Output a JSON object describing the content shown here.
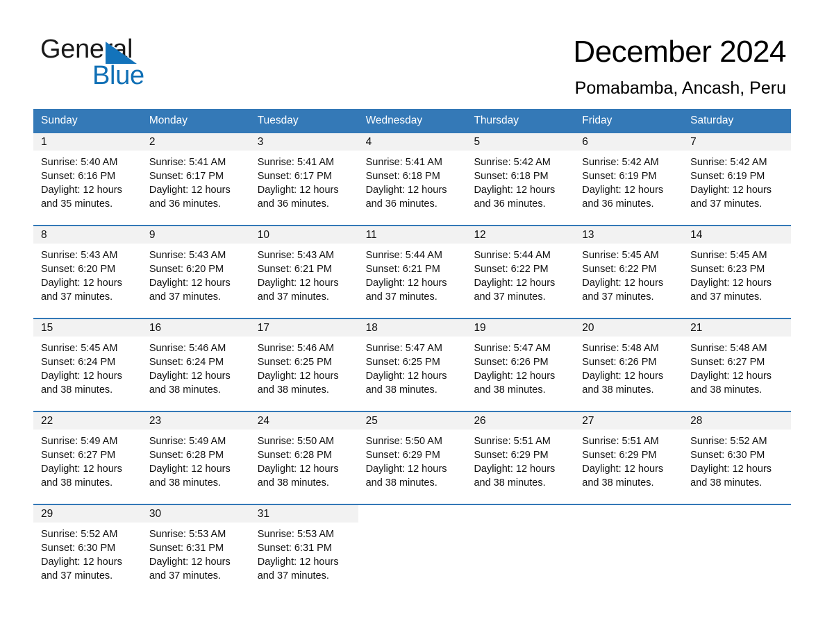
{
  "brand": {
    "word_one": "General",
    "word_two": "Blue",
    "triangle_color": "#1373bb",
    "blue_text_color": "#0f6fb5"
  },
  "header": {
    "month_title": "December 2024",
    "location": "Pomabamba, Ancash, Peru"
  },
  "calendar": {
    "header_bg": "#3479b7",
    "day_band_bg": "#f2f2f2",
    "weekdays": [
      "Sunday",
      "Monday",
      "Tuesday",
      "Wednesday",
      "Thursday",
      "Friday",
      "Saturday"
    ],
    "weeks": [
      [
        {
          "day": "1",
          "sunrise": "Sunrise: 5:40 AM",
          "sunset": "Sunset: 6:16 PM",
          "daylight_line1": "Daylight: 12 hours",
          "daylight_line2": "and 35 minutes."
        },
        {
          "day": "2",
          "sunrise": "Sunrise: 5:41 AM",
          "sunset": "Sunset: 6:17 PM",
          "daylight_line1": "Daylight: 12 hours",
          "daylight_line2": "and 36 minutes."
        },
        {
          "day": "3",
          "sunrise": "Sunrise: 5:41 AM",
          "sunset": "Sunset: 6:17 PM",
          "daylight_line1": "Daylight: 12 hours",
          "daylight_line2": "and 36 minutes."
        },
        {
          "day": "4",
          "sunrise": "Sunrise: 5:41 AM",
          "sunset": "Sunset: 6:18 PM",
          "daylight_line1": "Daylight: 12 hours",
          "daylight_line2": "and 36 minutes."
        },
        {
          "day": "5",
          "sunrise": "Sunrise: 5:42 AM",
          "sunset": "Sunset: 6:18 PM",
          "daylight_line1": "Daylight: 12 hours",
          "daylight_line2": "and 36 minutes."
        },
        {
          "day": "6",
          "sunrise": "Sunrise: 5:42 AM",
          "sunset": "Sunset: 6:19 PM",
          "daylight_line1": "Daylight: 12 hours",
          "daylight_line2": "and 36 minutes."
        },
        {
          "day": "7",
          "sunrise": "Sunrise: 5:42 AM",
          "sunset": "Sunset: 6:19 PM",
          "daylight_line1": "Daylight: 12 hours",
          "daylight_line2": "and 37 minutes."
        }
      ],
      [
        {
          "day": "8",
          "sunrise": "Sunrise: 5:43 AM",
          "sunset": "Sunset: 6:20 PM",
          "daylight_line1": "Daylight: 12 hours",
          "daylight_line2": "and 37 minutes."
        },
        {
          "day": "9",
          "sunrise": "Sunrise: 5:43 AM",
          "sunset": "Sunset: 6:20 PM",
          "daylight_line1": "Daylight: 12 hours",
          "daylight_line2": "and 37 minutes."
        },
        {
          "day": "10",
          "sunrise": "Sunrise: 5:43 AM",
          "sunset": "Sunset: 6:21 PM",
          "daylight_line1": "Daylight: 12 hours",
          "daylight_line2": "and 37 minutes."
        },
        {
          "day": "11",
          "sunrise": "Sunrise: 5:44 AM",
          "sunset": "Sunset: 6:21 PM",
          "daylight_line1": "Daylight: 12 hours",
          "daylight_line2": "and 37 minutes."
        },
        {
          "day": "12",
          "sunrise": "Sunrise: 5:44 AM",
          "sunset": "Sunset: 6:22 PM",
          "daylight_line1": "Daylight: 12 hours",
          "daylight_line2": "and 37 minutes."
        },
        {
          "day": "13",
          "sunrise": "Sunrise: 5:45 AM",
          "sunset": "Sunset: 6:22 PM",
          "daylight_line1": "Daylight: 12 hours",
          "daylight_line2": "and 37 minutes."
        },
        {
          "day": "14",
          "sunrise": "Sunrise: 5:45 AM",
          "sunset": "Sunset: 6:23 PM",
          "daylight_line1": "Daylight: 12 hours",
          "daylight_line2": "and 37 minutes."
        }
      ],
      [
        {
          "day": "15",
          "sunrise": "Sunrise: 5:45 AM",
          "sunset": "Sunset: 6:24 PM",
          "daylight_line1": "Daylight: 12 hours",
          "daylight_line2": "and 38 minutes."
        },
        {
          "day": "16",
          "sunrise": "Sunrise: 5:46 AM",
          "sunset": "Sunset: 6:24 PM",
          "daylight_line1": "Daylight: 12 hours",
          "daylight_line2": "and 38 minutes."
        },
        {
          "day": "17",
          "sunrise": "Sunrise: 5:46 AM",
          "sunset": "Sunset: 6:25 PM",
          "daylight_line1": "Daylight: 12 hours",
          "daylight_line2": "and 38 minutes."
        },
        {
          "day": "18",
          "sunrise": "Sunrise: 5:47 AM",
          "sunset": "Sunset: 6:25 PM",
          "daylight_line1": "Daylight: 12 hours",
          "daylight_line2": "and 38 minutes."
        },
        {
          "day": "19",
          "sunrise": "Sunrise: 5:47 AM",
          "sunset": "Sunset: 6:26 PM",
          "daylight_line1": "Daylight: 12 hours",
          "daylight_line2": "and 38 minutes."
        },
        {
          "day": "20",
          "sunrise": "Sunrise: 5:48 AM",
          "sunset": "Sunset: 6:26 PM",
          "daylight_line1": "Daylight: 12 hours",
          "daylight_line2": "and 38 minutes."
        },
        {
          "day": "21",
          "sunrise": "Sunrise: 5:48 AM",
          "sunset": "Sunset: 6:27 PM",
          "daylight_line1": "Daylight: 12 hours",
          "daylight_line2": "and 38 minutes."
        }
      ],
      [
        {
          "day": "22",
          "sunrise": "Sunrise: 5:49 AM",
          "sunset": "Sunset: 6:27 PM",
          "daylight_line1": "Daylight: 12 hours",
          "daylight_line2": "and 38 minutes."
        },
        {
          "day": "23",
          "sunrise": "Sunrise: 5:49 AM",
          "sunset": "Sunset: 6:28 PM",
          "daylight_line1": "Daylight: 12 hours",
          "daylight_line2": "and 38 minutes."
        },
        {
          "day": "24",
          "sunrise": "Sunrise: 5:50 AM",
          "sunset": "Sunset: 6:28 PM",
          "daylight_line1": "Daylight: 12 hours",
          "daylight_line2": "and 38 minutes."
        },
        {
          "day": "25",
          "sunrise": "Sunrise: 5:50 AM",
          "sunset": "Sunset: 6:29 PM",
          "daylight_line1": "Daylight: 12 hours",
          "daylight_line2": "and 38 minutes."
        },
        {
          "day": "26",
          "sunrise": "Sunrise: 5:51 AM",
          "sunset": "Sunset: 6:29 PM",
          "daylight_line1": "Daylight: 12 hours",
          "daylight_line2": "and 38 minutes."
        },
        {
          "day": "27",
          "sunrise": "Sunrise: 5:51 AM",
          "sunset": "Sunset: 6:29 PM",
          "daylight_line1": "Daylight: 12 hours",
          "daylight_line2": "and 38 minutes."
        },
        {
          "day": "28",
          "sunrise": "Sunrise: 5:52 AM",
          "sunset": "Sunset: 6:30 PM",
          "daylight_line1": "Daylight: 12 hours",
          "daylight_line2": "and 38 minutes."
        }
      ],
      [
        {
          "day": "29",
          "sunrise": "Sunrise: 5:52 AM",
          "sunset": "Sunset: 6:30 PM",
          "daylight_line1": "Daylight: 12 hours",
          "daylight_line2": "and 37 minutes."
        },
        {
          "day": "30",
          "sunrise": "Sunrise: 5:53 AM",
          "sunset": "Sunset: 6:31 PM",
          "daylight_line1": "Daylight: 12 hours",
          "daylight_line2": "and 37 minutes."
        },
        {
          "day": "31",
          "sunrise": "Sunrise: 5:53 AM",
          "sunset": "Sunset: 6:31 PM",
          "daylight_line1": "Daylight: 12 hours",
          "daylight_line2": "and 37 minutes."
        },
        {
          "day": "",
          "sunrise": "",
          "sunset": "",
          "daylight_line1": "",
          "daylight_line2": ""
        },
        {
          "day": "",
          "sunrise": "",
          "sunset": "",
          "daylight_line1": "",
          "daylight_line2": ""
        },
        {
          "day": "",
          "sunrise": "",
          "sunset": "",
          "daylight_line1": "",
          "daylight_line2": ""
        },
        {
          "day": "",
          "sunrise": "",
          "sunset": "",
          "daylight_line1": "",
          "daylight_line2": ""
        }
      ]
    ]
  }
}
